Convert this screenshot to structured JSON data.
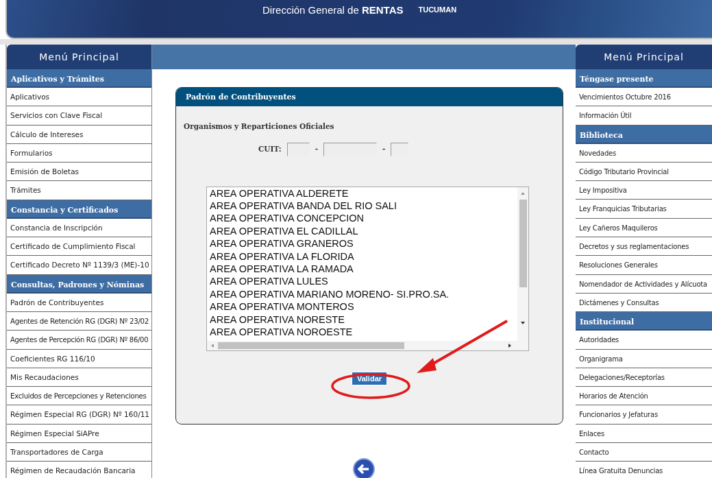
{
  "header": {
    "title": "Dirección General de **RENTAS**",
    "region": "TUCUMAN"
  },
  "left_menu": {
    "title": "Menú Principal",
    "sections": [
      {
        "heading": "Aplicativos y Trámites",
        "items": [
          "Aplicativos",
          "Servicios con Clave Fiscal",
          "Cálculo de Intereses",
          "Formularios",
          "Emisión de Boletas",
          "Trámites"
        ]
      },
      {
        "heading": "Constancia y Certificados",
        "items": [
          "Constancia de Inscripción",
          "Certificado de Cumplimiento Fiscal",
          "Certificado Decreto Nº 1139/3 (ME)-10"
        ]
      },
      {
        "heading": "Consultas, Padrones y Nóminas",
        "items": [
          "Padrón de Contribuyentes",
          "Agentes de Retención RG (DGR) Nº 23/02",
          "Agentes de Percepción RG (DGR) Nº 86/00",
          "Coeficientes RG 116/10",
          "Mis Recaudaciones",
          "Excluidos de Percepciones y Retenciones",
          "Régimen Especial RG (DGR) Nº 160/11",
          "Régimen Especial SiAPre",
          "Transportadores de Carga",
          "Régimen de Recaudación Bancaria"
        ]
      }
    ]
  },
  "panel": {
    "title": "Padrón de Contribuyentes",
    "subtitle": "Organismos y Reparticiones Oficiales",
    "cuit": {
      "label": "CUIT:",
      "separators": [
        "-",
        "-"
      ]
    },
    "options": [
      "AREA OPERATIVA ALDERETE",
      "AREA OPERATIVA BANDA DEL RIO SALI",
      "AREA OPERATIVA CONCEPCION",
      "AREA OPERATIVA EL CADILLAL",
      "AREA OPERATIVA GRANEROS",
      "AREA OPERATIVA LA FLORIDA",
      "AREA OPERATIVA LA RAMADA",
      "AREA OPERATIVA LULES",
      "AREA OPERATIVA MARIANO MORENO- SI.PRO.SA.",
      "AREA OPERATIVA MONTEROS",
      "AREA OPERATIVA NORESTE",
      "AREA OPERATIVA NOROESTE"
    ],
    "button": "Validar"
  },
  "right_menu": {
    "title": "Menú Principal",
    "sections": [
      {
        "heading": "Téngase presente",
        "items": [
          "Vencimientos Octubre 2016",
          "Información Útil"
        ]
      },
      {
        "heading": "Biblioteca",
        "items": [
          "Novedades",
          "Código Tributario Provincial",
          "Ley Impositiva",
          "Ley Franquicias Tributarias",
          "Ley Cañeros Maquileros",
          "Decretos y sus reglamentaciones",
          "Resoluciones Generales",
          "Nomendador de Actividades y Alícuota",
          "Dictámenes y Consultas"
        ]
      },
      {
        "heading": "Institucional",
        "items": [
          "Autoridades",
          "Organigrama",
          "Delegaciones/Receptorías",
          "Horarios de Atención",
          "Funcionarios y Jefaturas",
          "Enlaces",
          "Contacto",
          "Línea Gratuita Denuncias"
        ]
      }
    ]
  }
}
